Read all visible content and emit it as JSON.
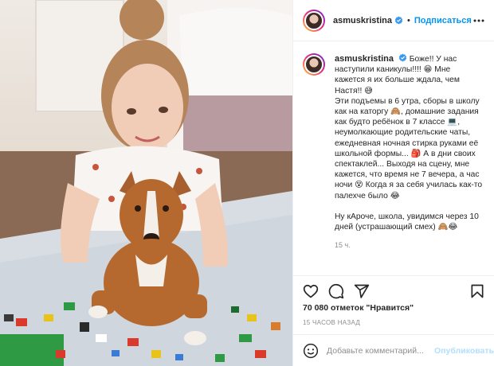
{
  "header": {
    "username": "asmuskristina",
    "separator": "•",
    "follow_label": "Подписаться"
  },
  "caption": {
    "username": "asmuskristina",
    "text": "Боже!! У нас наступили каникулы!!!! 😁 Мне кажется я их больше ждала, чем Настя!! 😅\nЭти подъемы в 6 утра, сборы в школу как на каторгу 🙈, домашние задания как будто ребёнок в 7 классе 💻, неумолкающие родительские чаты, ежедневная ночная стирка руками её школьной формы... 🎒 А в дни своих спектаклей... Выходя на сцену, мне кажется, что время не 7 вечера, а час ночи 😵 Когда я за себя училась как-то палехче было 😂\n\nНу кАроче, школа, увидимся через 10 дней (устрашающий смех) 🙈😂",
    "time": "15 ч."
  },
  "stats": {
    "likes": "70 080 отметок \"Нравится\"",
    "posted_ago": "15 ЧАСОВ НАЗАД"
  },
  "comment_box": {
    "placeholder": "Добавьте комментарий...",
    "publish_label": "Опубликовать"
  },
  "icons": {
    "like": "heart-icon",
    "comment": "comment-icon",
    "share": "paper-plane-icon",
    "save": "bookmark-icon",
    "more": "more-options-icon",
    "emoji": "smiley-icon",
    "verified": "verified-badge-icon"
  },
  "colors": {
    "link": "#0095f6",
    "publish_disabled": "#b2dffc",
    "muted": "#8e8e8e",
    "verified": "#3897f0"
  }
}
